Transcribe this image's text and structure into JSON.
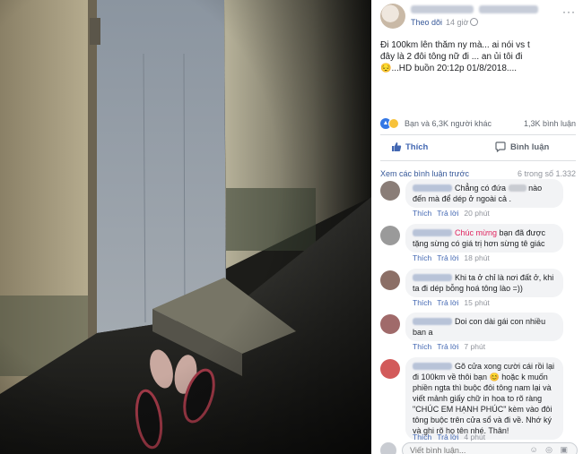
{
  "post": {
    "follow_label": "Theo dõi",
    "dot": "·",
    "time": "14 giờ",
    "more": "···",
    "text": "Đi 100km lên thăm ny mà... ai nói vs t đây là 2 đôi tông nữ đi ... an ủi tôi đi 😔...HD buồn 20:12p 01/8/2018....",
    "reactions_text": "Bạn và 6,3K người khác",
    "comments_count": "1,3K bình luận",
    "like_label": "Thích",
    "comment_label": "Bình luận"
  },
  "comments_header": {
    "view_previous": "Xem các bình luận trước",
    "progress": "6 trong số 1.332"
  },
  "comments": [
    {
      "text_a": "Chẳng có đứa",
      "text_b": "nào đến mà để dép ở ngoài cả .",
      "like": "Thích",
      "reply": "Trả lời",
      "time": "20 phút",
      "avatar_color": "#8a7d77"
    },
    {
      "highlight": "Chúc mừng",
      "text_b": " bạn đã được tặng sừng có giá trị hơn sừng tê giác",
      "like": "Thích",
      "reply": "Trả lời",
      "time": "18 phút",
      "avatar_color": "#9a9a9a"
    },
    {
      "text_a": "Khi ta ở chỉ là nơi đất ở, khi ta đi dép bỗng hoá tông lào =))",
      "like": "Thích",
      "reply": "Trả lời",
      "time": "15 phút",
      "avatar_color": "#8c6f66"
    },
    {
      "text_a": "Doi con dài gái con nhiều ban a",
      "like": "Thích",
      "reply": "Trả lời",
      "time": "7 phút",
      "avatar_color": "#a06a6a"
    },
    {
      "text_a": "Gõ cửa xong cười cái rồi lại đi 100km về thôi bạn 😊 hoặc k muốn phiền ngta thì buộc đôi tông nam lại và viết mảnh giấy chữ in hoa to rõ ràng \"CHÚC EM HẠNH PHÚC\" kèm vào đôi tông buộc trên cửa sổ và đi về. Nhớ ký và ghi rõ họ tên nhé. Thân!",
      "like": "Thích",
      "reply": "Trả lời",
      "time": "4 phút",
      "avatar_color": "#d25a5a"
    }
  ],
  "write_comment": {
    "placeholder": "Viết bình luận...",
    "icons": "☺ ◎ ▣"
  },
  "photo": {
    "description_icon": "photo"
  }
}
